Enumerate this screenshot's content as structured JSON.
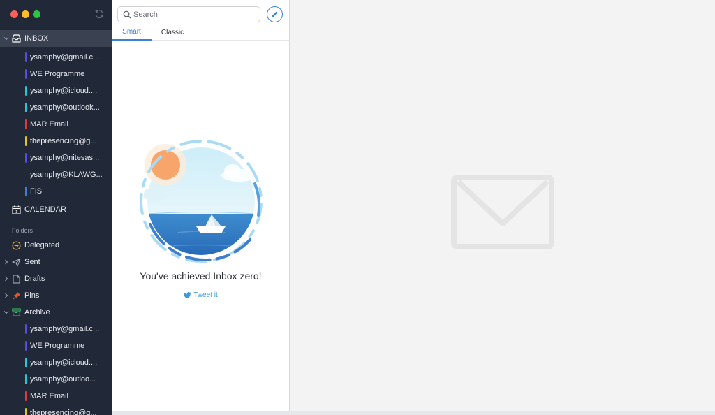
{
  "sidebar": {
    "inbox": {
      "label": "INBOX"
    },
    "inbox_accounts": [
      {
        "label": "ysamphy@gmail.c...",
        "color": "#5b4be0"
      },
      {
        "label": "WE Programme",
        "color": "#5b4be0"
      },
      {
        "label": "ysamphy@icloud....",
        "color": "#2bc3e0"
      },
      {
        "label": "ysamphy@outlook...",
        "color": "#2bc3e0"
      },
      {
        "label": "MAR Email",
        "color": "#e23a3a"
      },
      {
        "label": "thepresencing@g...",
        "color": "#e8c326"
      },
      {
        "label": "ysamphy@nitesas...",
        "color": "#5b4be0"
      },
      {
        "label": "ysamphy@KLAWG...",
        "color": ""
      },
      {
        "label": "FIS",
        "color": "#3b82d6"
      }
    ],
    "calendar": {
      "label": "CALENDAR",
      "day": "1"
    },
    "folders_header": "Folders",
    "folders": [
      {
        "label": "Delegated",
        "icon": "delegated-icon",
        "color": "#e8a43b"
      },
      {
        "label": "Sent",
        "icon": "sent-icon"
      },
      {
        "label": "Drafts",
        "icon": "drafts-icon"
      },
      {
        "label": "Pins",
        "icon": "pin-icon",
        "color": "#e2552b"
      },
      {
        "label": "Archive",
        "icon": "archive-icon",
        "color": "#3cc46b"
      }
    ],
    "archive_accounts": [
      {
        "label": "ysamphy@gmail.c...",
        "color": "#5b4be0"
      },
      {
        "label": "WE Programme",
        "color": "#5b4be0"
      },
      {
        "label": "ysamphy@icloud....",
        "color": "#2bc3e0"
      },
      {
        "label": "ysamphy@outloo...",
        "color": "#2bc3e0"
      },
      {
        "label": "MAR Email",
        "color": "#e23a3a"
      },
      {
        "label": "thepresencing@g...",
        "color": "#e8c326"
      }
    ]
  },
  "list": {
    "search_placeholder": "Search",
    "tabs": [
      {
        "label": "Smart"
      },
      {
        "label": "Classic"
      }
    ],
    "empty_message": "You've achieved Inbox zero!",
    "tweet_label": "Tweet it"
  },
  "colors": {
    "accent": "#3b82d6",
    "sidebar_bg": "#212837",
    "sidebar_selected": "#3a4252"
  }
}
